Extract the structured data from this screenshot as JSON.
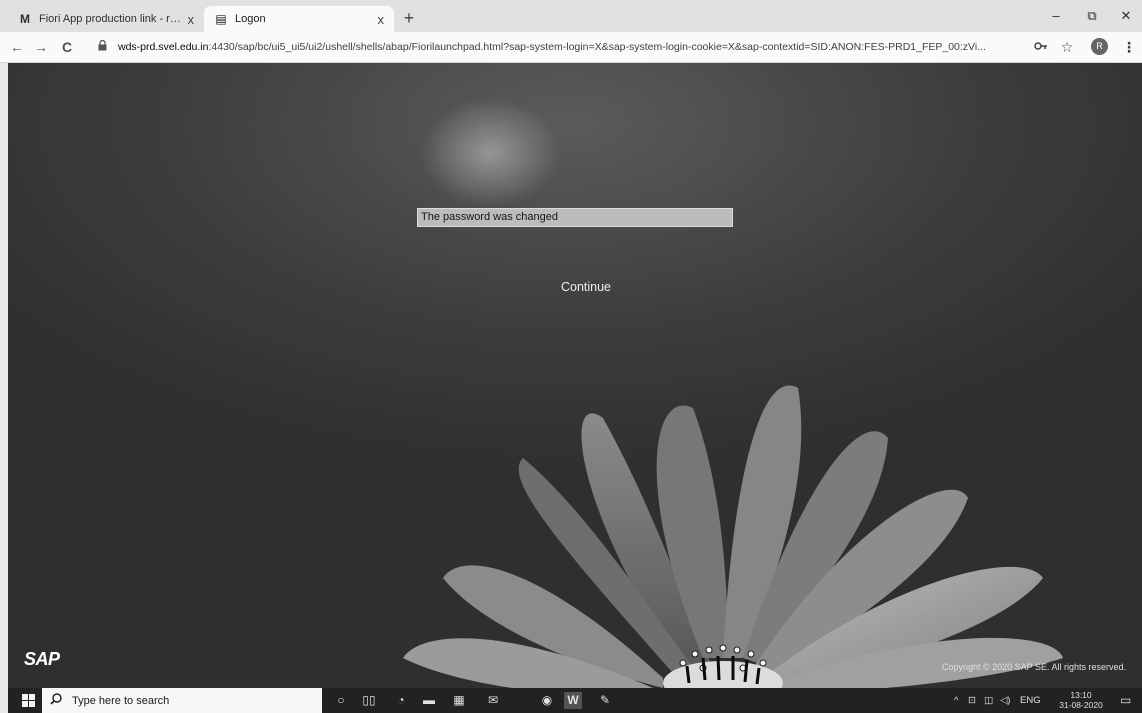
{
  "browser": {
    "tabs": [
      {
        "favicon": "gmail-icon",
        "favicon_glyph": "M",
        "title": "Fiori App production link - range",
        "close": "x"
      },
      {
        "favicon": "sap-logon-icon",
        "favicon_glyph": "▤",
        "title": "Logon",
        "close": "x"
      }
    ],
    "new_tab": "+",
    "window_controls": {
      "minimize": "–",
      "restore": "⧉",
      "close": "✕"
    },
    "nav": {
      "back": "←",
      "forward": "→",
      "reload": "C"
    },
    "url_host": "wds-prd.svel.edu.in",
    "url_rest": ":4430/sap/bc/ui5_ui5/ui2/ushell/shells/abap/Fiorilaunchpad.html?sap-system-login=X&sap-system-login-cookie=X&sap-contextid=SID:ANON:FES-PRD1_FEP_00:zVi...",
    "profile_initial": "R"
  },
  "page": {
    "message": "The password was changed",
    "continue_label": "Continue",
    "logo_text": "SAP",
    "copyright": "Copyright © 2020 SAP SE. All rights reserved."
  },
  "taskbar": {
    "search_placeholder": "Type here to search",
    "tray_lang": "ENG",
    "time": "13:10",
    "date": "31-08-2020"
  }
}
